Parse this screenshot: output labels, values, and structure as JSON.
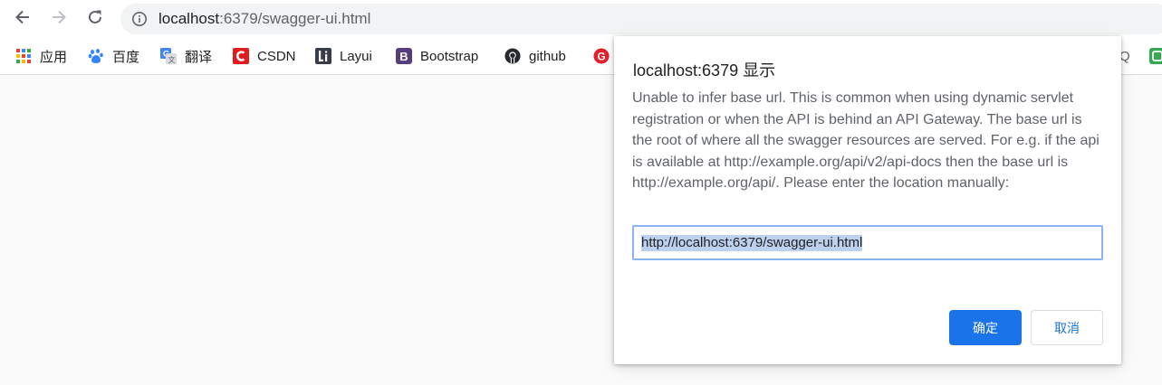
{
  "toolbar": {
    "back_icon": "back-arrow-icon",
    "forward_icon": "forward-arrow-icon",
    "reload_icon": "reload-icon",
    "info_icon": "info-icon",
    "url_host": "localhost",
    "url_path": ":6379/swagger-ui.html"
  },
  "bookmarks": [
    {
      "label": "应用",
      "icon": "apps-grid-icon"
    },
    {
      "label": "百度",
      "icon": "baidu-paw-icon"
    },
    {
      "label": "翻译",
      "icon": "google-translate-icon"
    },
    {
      "label": "CSDN",
      "icon": "csdn-icon"
    },
    {
      "label": "Layui",
      "icon": "layui-icon"
    },
    {
      "label": "Bootstrap",
      "icon": "bootstrap-icon"
    },
    {
      "label": "github",
      "icon": "github-icon"
    },
    {
      "label": "",
      "icon": "red-g-icon"
    }
  ],
  "bookmarks_tail": {
    "text": "Q",
    "icon": "green-icon"
  },
  "dialog": {
    "title": "localhost:6379 显示",
    "message": "Unable to infer base url. This is common when using dynamic servlet registration or when the API is behind an API Gateway. The base url is the root of where all the swagger resources are served. For e.g. if the api is available at http://example.org/api/v2/api-docs then the base url is http://example.org/api/. Please enter the location manually:",
    "input_value": "http://localhost:6379/swagger-ui.html",
    "ok_label": "确定",
    "cancel_label": "取消"
  },
  "colors": {
    "accent": "#1a73e8",
    "selection": "#bdd1ee",
    "page_background": "#fafafa"
  }
}
